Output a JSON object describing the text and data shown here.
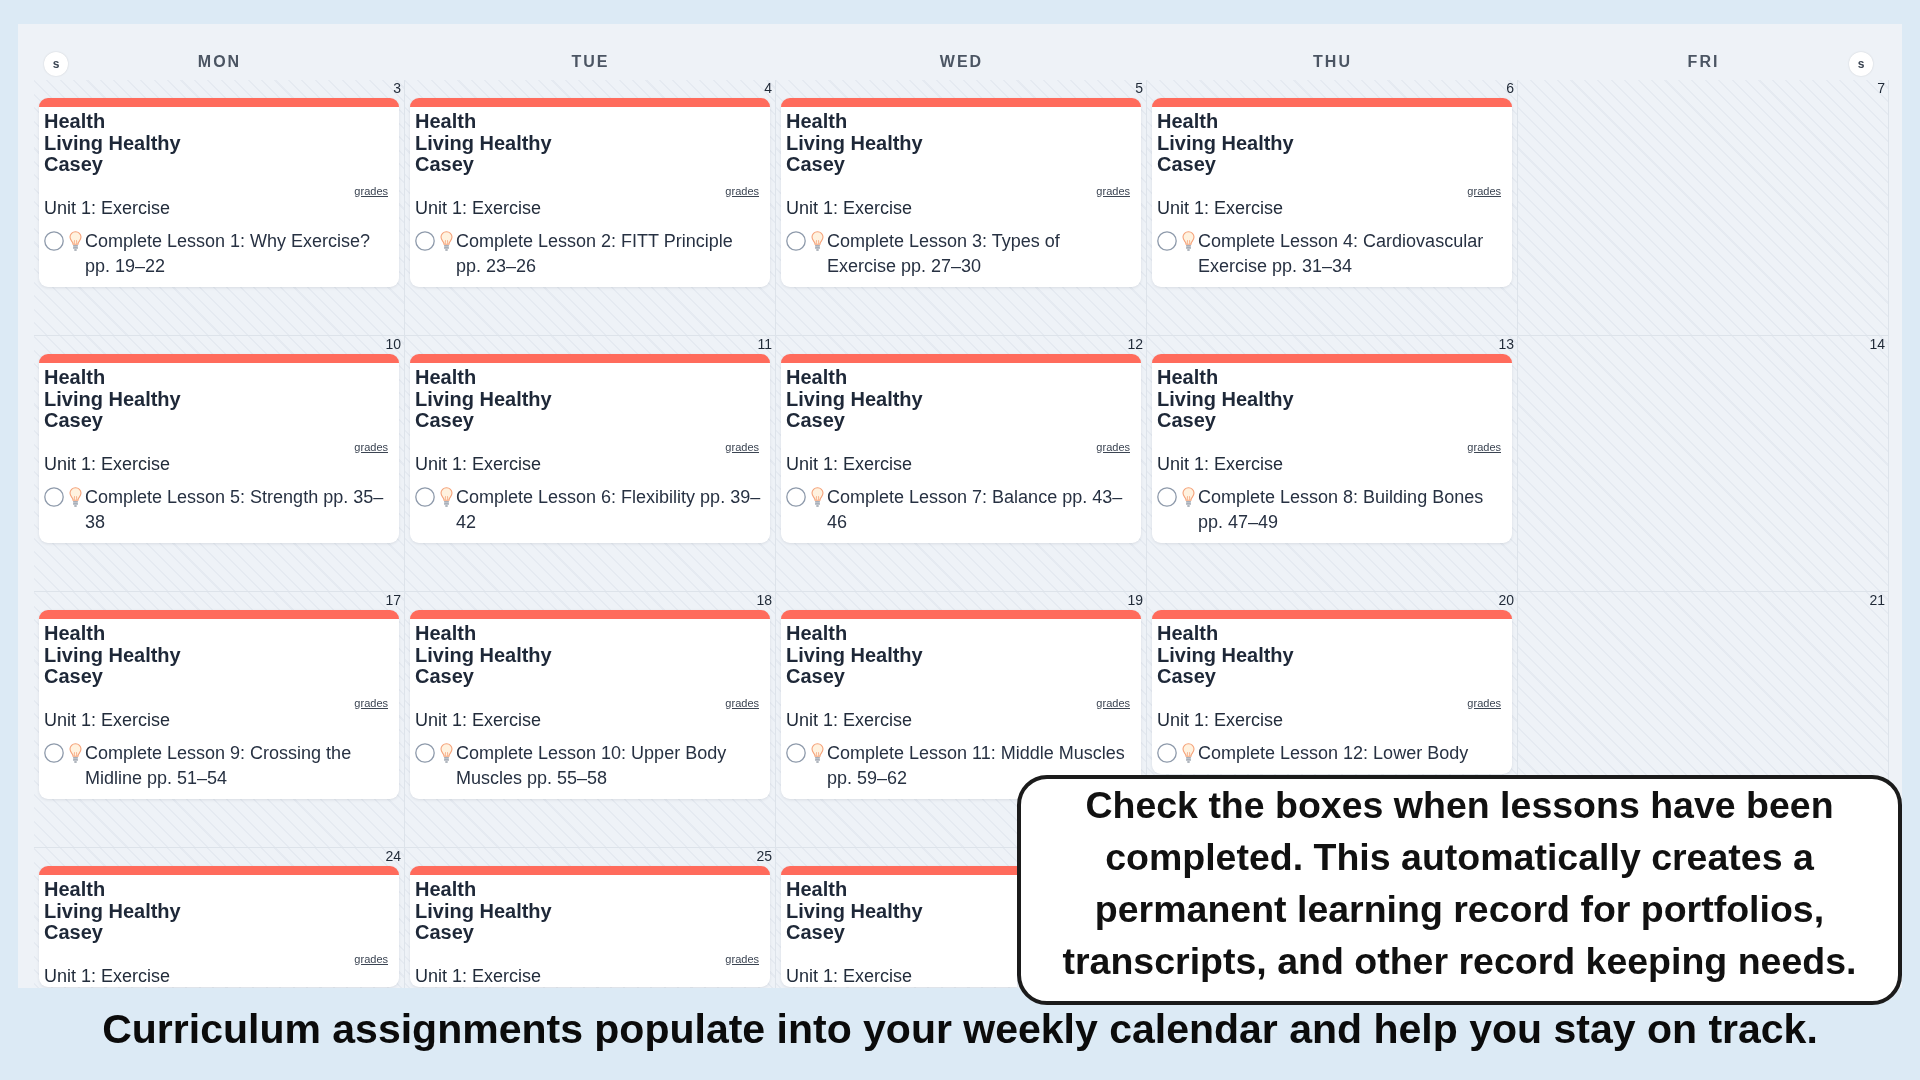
{
  "calendar": {
    "header": {
      "left_toggle": "s",
      "days": [
        "MON",
        "TUE",
        "WED",
        "THU",
        "FRI"
      ],
      "right_toggle": "s"
    },
    "weeks": [
      {
        "days": [
          {
            "date": "3",
            "events": [
              {
                "subject": "Health",
                "course": "Living Healthy",
                "student": "Casey",
                "link": "grades",
                "unit": "Unit 1: Exercise",
                "tasks": [
                  {
                    "text": "Complete Lesson 1: Why Exercise? pp. 19–22",
                    "checked": false
                  }
                ]
              }
            ]
          },
          {
            "date": "4",
            "events": [
              {
                "subject": "Health",
                "course": "Living Healthy",
                "student": "Casey",
                "link": "grades",
                "unit": "Unit 1: Exercise",
                "tasks": [
                  {
                    "text": "Complete Lesson 2: FITT Principle pp. 23–26",
                    "checked": false
                  }
                ]
              }
            ]
          },
          {
            "date": "5",
            "events": [
              {
                "subject": "Health",
                "course": "Living Healthy",
                "student": "Casey",
                "link": "grades",
                "unit": "Unit 1: Exercise",
                "tasks": [
                  {
                    "text": "Complete Lesson 3: Types of Exercise pp. 27–30",
                    "checked": false
                  }
                ]
              }
            ]
          },
          {
            "date": "6",
            "events": [
              {
                "subject": "Health",
                "course": "Living Healthy",
                "student": "Casey",
                "link": "grades",
                "unit": "Unit 1: Exercise",
                "tasks": [
                  {
                    "text": "Complete Lesson 4: Cardiovascular Exercise pp. 31–34",
                    "checked": false
                  }
                ]
              }
            ]
          },
          {
            "date": "7"
          }
        ]
      },
      {
        "days": [
          {
            "date": "10",
            "events": [
              {
                "subject": "Health",
                "course": "Living Healthy",
                "student": "Casey",
                "link": "grades",
                "unit": "Unit 1: Exercise",
                "tasks": [
                  {
                    "text": "Complete Lesson 5: Strength pp. 35–38",
                    "checked": false
                  }
                ]
              }
            ]
          },
          {
            "date": "11",
            "events": [
              {
                "subject": "Health",
                "course": "Living Healthy",
                "student": "Casey",
                "link": "grades",
                "unit": "Unit 1: Exercise",
                "tasks": [
                  {
                    "text": "Complete Lesson 6: Flexibility pp. 39–42",
                    "checked": false
                  }
                ]
              }
            ]
          },
          {
            "date": "12",
            "events": [
              {
                "subject": "Health",
                "course": "Living Healthy",
                "student": "Casey",
                "link": "grades",
                "unit": "Unit 1: Exercise",
                "tasks": [
                  {
                    "text": "Complete Lesson 7: Balance pp. 43–46",
                    "checked": false
                  }
                ]
              }
            ]
          },
          {
            "date": "13",
            "events": [
              {
                "subject": "Health",
                "course": "Living Healthy",
                "student": "Casey",
                "link": "grades",
                "unit": "Unit 1: Exercise",
                "tasks": [
                  {
                    "text": "Complete Lesson 8: Building Bones pp. 47–49",
                    "checked": false
                  }
                ]
              }
            ]
          },
          {
            "date": "14"
          }
        ]
      },
      {
        "days": [
          {
            "date": "17",
            "events": [
              {
                "subject": "Health",
                "course": "Living Healthy",
                "student": "Casey",
                "link": "grades",
                "unit": "Unit 1: Exercise",
                "tasks": [
                  {
                    "text": "Complete Lesson 9: Crossing the Midline pp. 51–54",
                    "checked": false
                  }
                ]
              }
            ]
          },
          {
            "date": "18",
            "events": [
              {
                "subject": "Health",
                "course": "Living Healthy",
                "student": "Casey",
                "link": "grades",
                "unit": "Unit 1: Exercise",
                "tasks": [
                  {
                    "text": "Complete Lesson 10: Upper Body Muscles pp. 55–58",
                    "checked": false
                  }
                ]
              }
            ]
          },
          {
            "date": "19",
            "events": [
              {
                "subject": "Health",
                "course": "Living Healthy",
                "student": "Casey",
                "link": "grades",
                "unit": "Unit 1: Exercise",
                "tasks": [
                  {
                    "text": "Complete Lesson 11: Middle Muscles pp. 59–62",
                    "checked": false
                  }
                ]
              }
            ]
          },
          {
            "date": "20",
            "events": [
              {
                "subject": "Health",
                "course": "Living Healthy",
                "student": "Casey",
                "link": "grades",
                "unit": "Unit 1: Exercise",
                "tasks": [
                  {
                    "text": "Complete Lesson 12: Lower Body",
                    "checked": false
                  }
                ]
              }
            ]
          },
          {
            "date": "21"
          }
        ]
      },
      {
        "days": [
          {
            "date": "24",
            "events": [
              {
                "subject": "Health",
                "course": "Living Healthy",
                "student": "Casey",
                "link": "grades",
                "unit": "Unit 1: Exercise"
              }
            ]
          },
          {
            "date": "25",
            "events": [
              {
                "subject": "Health",
                "course": "Living Healthy",
                "student": "Casey",
                "link": "grades",
                "unit": "Unit 1: Exercise"
              }
            ]
          },
          {
            "events": [
              {
                "subject": "Health",
                "course": "Living Healthy",
                "student": "Casey",
                "unit": "Unit 1: Exercise"
              }
            ]
          }
        ]
      }
    ]
  },
  "callout": {
    "text": "Check the boxes when lessons have been completed. This automatically creates a permanent learning record for portfolios, transcripts, and other record keeping needs."
  },
  "caption": "Curriculum assignments populate into your weekly calendar and help you stay on track."
}
